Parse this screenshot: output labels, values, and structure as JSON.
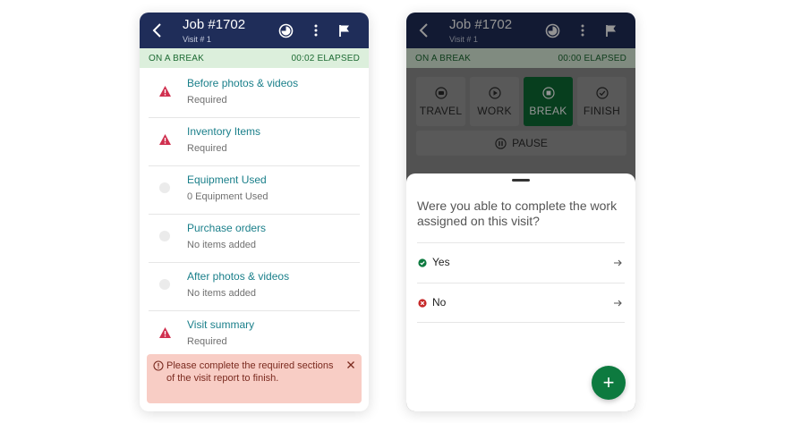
{
  "left_screen": {
    "header": {
      "title": "Job #1702",
      "subtitle": "Visit # 1"
    },
    "status": {
      "state": "ON A BREAK",
      "elapsed": "00:02 ELAPSED"
    },
    "items": [
      {
        "title": "Before photos & videos",
        "subtitle": "Required",
        "icon": "warning-icon"
      },
      {
        "title": "Inventory Items",
        "subtitle": "Required",
        "icon": "warning-icon"
      },
      {
        "title": "Equipment Used",
        "subtitle": "0 Equipment Used",
        "icon": "empty-dot-icon"
      },
      {
        "title": "Purchase orders",
        "subtitle": "No items added",
        "icon": "empty-dot-icon"
      },
      {
        "title": "After photos & videos",
        "subtitle": "No items added",
        "icon": "empty-dot-icon"
      },
      {
        "title": "Visit summary",
        "subtitle": "Required",
        "icon": "warning-icon"
      }
    ],
    "error": {
      "message": "Please complete the required sections of the visit report to finish."
    }
  },
  "right_screen": {
    "header": {
      "title": "Job #1702",
      "subtitle": "Visit # 1"
    },
    "status": {
      "state": "ON A BREAK",
      "elapsed": "00:00 ELAPSED"
    },
    "modes": [
      {
        "label": "TRAVEL",
        "active": false
      },
      {
        "label": "WORK",
        "active": false
      },
      {
        "label": "BREAK",
        "active": true
      },
      {
        "label": "FINISH",
        "active": false
      }
    ],
    "pause_label": "PAUSE",
    "sheet": {
      "question": "Were you able to complete the work assigned on this visit?",
      "options": [
        {
          "label": "Yes",
          "icon": "check-circle-icon"
        },
        {
          "label": "No",
          "icon": "x-circle-icon"
        }
      ],
      "fab_label": "+"
    }
  },
  "colors": {
    "header": "#1f2d59",
    "status_bg": "#dcefdc",
    "status_text": "#1d6b33",
    "link": "#1a7f8a",
    "warning": "#d0304f",
    "error_bg": "#f8cdc5",
    "accent_green": "#0d7a3f"
  }
}
